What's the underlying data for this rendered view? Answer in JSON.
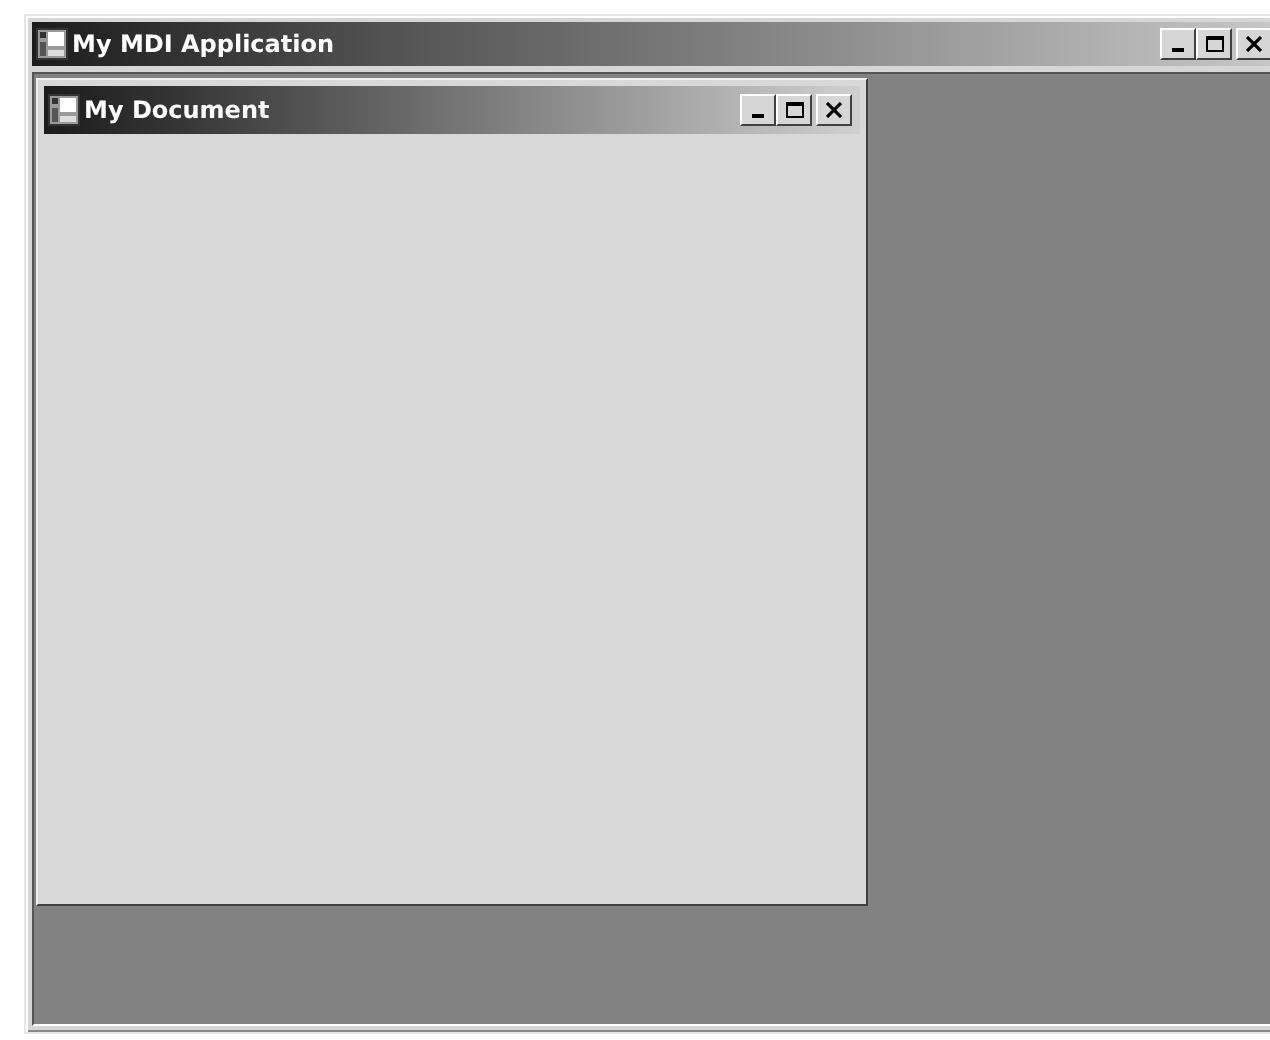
{
  "app_window": {
    "title": "My MDI Application"
  },
  "document_window": {
    "title": "My Document"
  }
}
